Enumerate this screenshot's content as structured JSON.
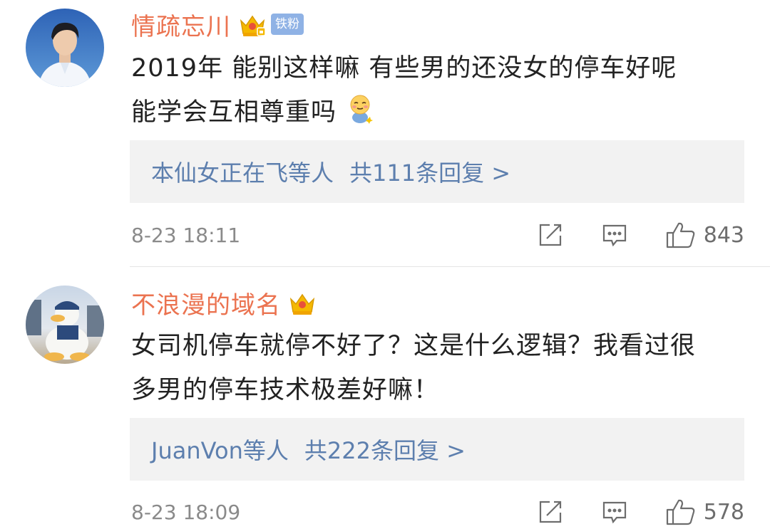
{
  "comments": [
    {
      "username": "情疏忘川",
      "badge_fan": "铁粉",
      "content_line1": "2019年 能别这样嘛 有些男的还没女的停车好呢",
      "content_line2": "能学会互相尊重吗",
      "reply_users": "本仙女正在飞等人",
      "reply_total": "共111条回复 >",
      "timestamp": "8-23 18:11",
      "likes": "843",
      "avatar_icon": "young-man-avatar",
      "emoji_icon": "shy-face-emoji"
    },
    {
      "username": "不浪漫的域名",
      "content_line1": "女司机停车就停不好了？这是什么逻辑？我看过很",
      "content_line2": "多男的停车技术极差好嘛！",
      "reply_users": "JuanVon等人",
      "reply_total": "共222条回复 >",
      "timestamp": "8-23 18:09",
      "likes": "578",
      "avatar_icon": "duck-plush-avatar"
    }
  ],
  "colors": {
    "username": "#eb7350",
    "reply_text": "#5d7fae",
    "reply_bg": "#f2f2f2",
    "badge_fan_bg": "#8fb2e5",
    "crown": "#f5b800",
    "meta_text": "#8a8a8a",
    "divider": "#e4e4e4"
  }
}
